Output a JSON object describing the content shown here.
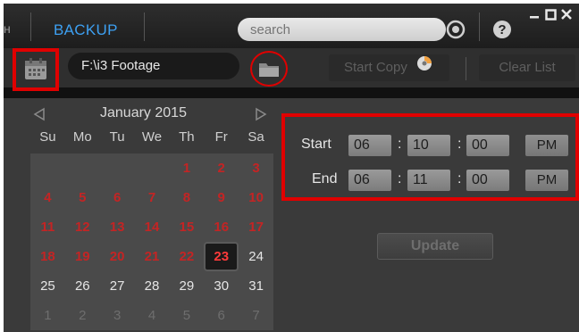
{
  "topbar": {
    "left_edge_glyph": "ʜ",
    "tab_backup": "BACKUP",
    "search_placeholder": "search",
    "window_controls": [
      "minimize-icon",
      "maximize-icon",
      "close-icon"
    ]
  },
  "pathbar": {
    "path_value": "F:\\i3 Footage",
    "start_copy_label": "Start Copy",
    "clear_list_label": "Clear List"
  },
  "calendar": {
    "month_label": "January 2015",
    "weekdays": [
      "Su",
      "Mo",
      "Tu",
      "We",
      "Th",
      "Fr",
      "Sa"
    ],
    "weeks": [
      [
        {
          "d": "",
          "s": ""
        },
        {
          "d": "",
          "s": ""
        },
        {
          "d": "",
          "s": ""
        },
        {
          "d": "",
          "s": ""
        },
        {
          "d": "1",
          "s": "red"
        },
        {
          "d": "2",
          "s": "red"
        },
        {
          "d": "3",
          "s": "red"
        }
      ],
      [
        {
          "d": "4",
          "s": "red"
        },
        {
          "d": "5",
          "s": "red"
        },
        {
          "d": "6",
          "s": "red"
        },
        {
          "d": "7",
          "s": "red"
        },
        {
          "d": "8",
          "s": "red"
        },
        {
          "d": "9",
          "s": "red"
        },
        {
          "d": "10",
          "s": "red"
        }
      ],
      [
        {
          "d": "11",
          "s": "red"
        },
        {
          "d": "12",
          "s": "red"
        },
        {
          "d": "13",
          "s": "red"
        },
        {
          "d": "14",
          "s": "red"
        },
        {
          "d": "15",
          "s": "red"
        },
        {
          "d": "16",
          "s": "red"
        },
        {
          "d": "17",
          "s": "red"
        }
      ],
      [
        {
          "d": "18",
          "s": "red"
        },
        {
          "d": "19",
          "s": "red"
        },
        {
          "d": "20",
          "s": "red"
        },
        {
          "d": "21",
          "s": "red"
        },
        {
          "d": "22",
          "s": "red"
        },
        {
          "d": "23",
          "s": "today"
        },
        {
          "d": "24",
          "s": ""
        }
      ],
      [
        {
          "d": "25",
          "s": ""
        },
        {
          "d": "26",
          "s": ""
        },
        {
          "d": "27",
          "s": ""
        },
        {
          "d": "28",
          "s": ""
        },
        {
          "d": "29",
          "s": ""
        },
        {
          "d": "30",
          "s": ""
        },
        {
          "d": "31",
          "s": ""
        }
      ],
      [
        {
          "d": "1",
          "s": "dim"
        },
        {
          "d": "2",
          "s": "dim"
        },
        {
          "d": "3",
          "s": "dim"
        },
        {
          "d": "4",
          "s": "dim"
        },
        {
          "d": "5",
          "s": "dim"
        },
        {
          "d": "6",
          "s": "dim"
        },
        {
          "d": "7",
          "s": "dim"
        }
      ]
    ]
  },
  "time": {
    "start_label": "Start",
    "start_hour": "06",
    "start_min": "10",
    "start_sec": "00",
    "start_ampm": "PM",
    "end_label": "End",
    "end_hour": "06",
    "end_min": "11",
    "end_sec": "00",
    "end_ampm": "PM",
    "colon": ":"
  },
  "update_label": "Update",
  "colors": {
    "accent_blue": "#3da0f2",
    "highlight_red": "#e00000",
    "date_red": "#c42424"
  }
}
